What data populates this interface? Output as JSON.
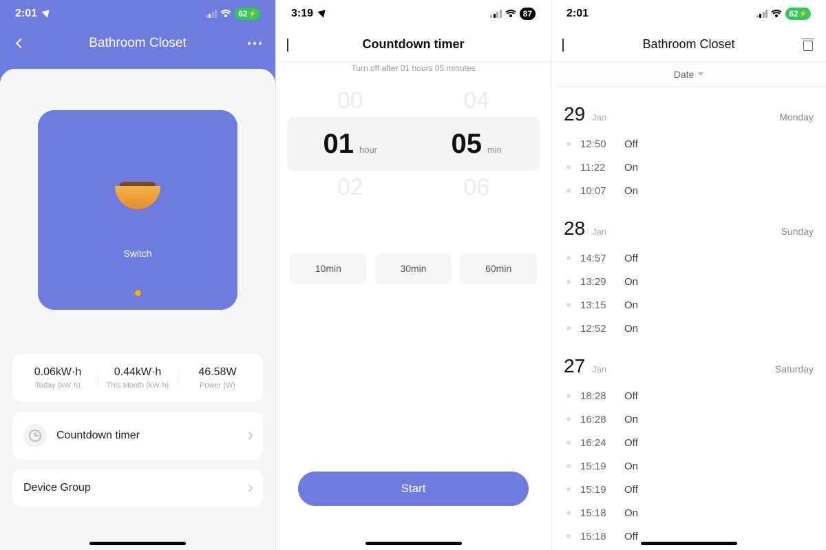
{
  "pane1": {
    "status_time": "2:01",
    "battery": "62",
    "title": "Bathroom Closet",
    "tile_label": "Switch",
    "stats": [
      {
        "value": "0.06kW·h",
        "label": "Today (kW·h)"
      },
      {
        "value": "0.44kW·h",
        "label": "This Month (kW·h)"
      },
      {
        "value": "46.58W",
        "label": "Power (W)"
      }
    ],
    "row_timer": "Countdown timer",
    "row_group": "Device Group"
  },
  "pane2": {
    "status_time": "3:19",
    "battery": "87",
    "title": "Countdown timer",
    "subtitle": "Turn off after 01 hours 05 minutes",
    "prev_hour": "00",
    "prev_min": "04",
    "sel_hour": "01",
    "sel_min": "05",
    "next_hour": "02",
    "next_min": "06",
    "unit_hour": "hour",
    "unit_min": "min",
    "presets": [
      "10min",
      "30min",
      "60min"
    ],
    "start": "Start"
  },
  "pane3": {
    "status_time": "2:01",
    "battery": "62",
    "title": "Bathroom Closet",
    "filter": "Date",
    "days": [
      {
        "num": "29",
        "mon": "Jan",
        "dow": "Monday",
        "events": [
          {
            "t": "12:50",
            "s": "Off"
          },
          {
            "t": "11:22",
            "s": "On"
          },
          {
            "t": "10:07",
            "s": "On"
          }
        ]
      },
      {
        "num": "28",
        "mon": "Jan",
        "dow": "Sunday",
        "events": [
          {
            "t": "14:57",
            "s": "Off"
          },
          {
            "t": "13:29",
            "s": "On"
          },
          {
            "t": "13:15",
            "s": "On"
          },
          {
            "t": "12:52",
            "s": "On"
          }
        ]
      },
      {
        "num": "27",
        "mon": "Jan",
        "dow": "Saturday",
        "events": [
          {
            "t": "18:28",
            "s": "Off"
          },
          {
            "t": "16:28",
            "s": "On"
          },
          {
            "t": "16:24",
            "s": "Off"
          },
          {
            "t": "15:19",
            "s": "On"
          },
          {
            "t": "15:19",
            "s": "Off"
          },
          {
            "t": "15:18",
            "s": "On"
          },
          {
            "t": "15:18",
            "s": "Off"
          }
        ]
      }
    ]
  }
}
